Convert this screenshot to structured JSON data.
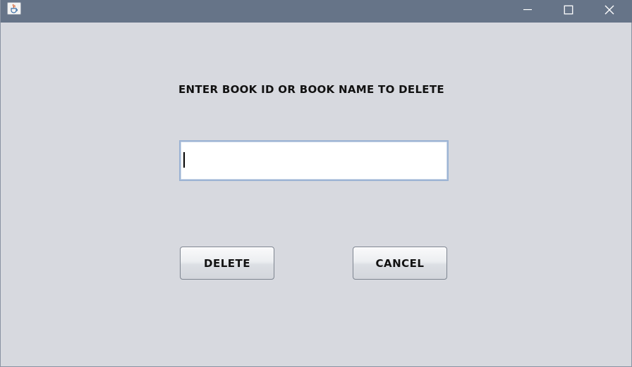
{
  "window": {
    "titlebar_color": "#667488",
    "background_color": "#d7d9df",
    "app_icon": "java-coffee-icon",
    "controls": {
      "minimize_icon": "minimize-icon",
      "maximize_icon": "maximize-icon",
      "close_icon": "close-icon"
    }
  },
  "form": {
    "prompt": "ENTER BOOK ID OR BOOK NAME TO DELETE",
    "input_value": "",
    "input_placeholder": ""
  },
  "buttons": {
    "delete_label": "DELETE",
    "cancel_label": "CANCEL"
  }
}
